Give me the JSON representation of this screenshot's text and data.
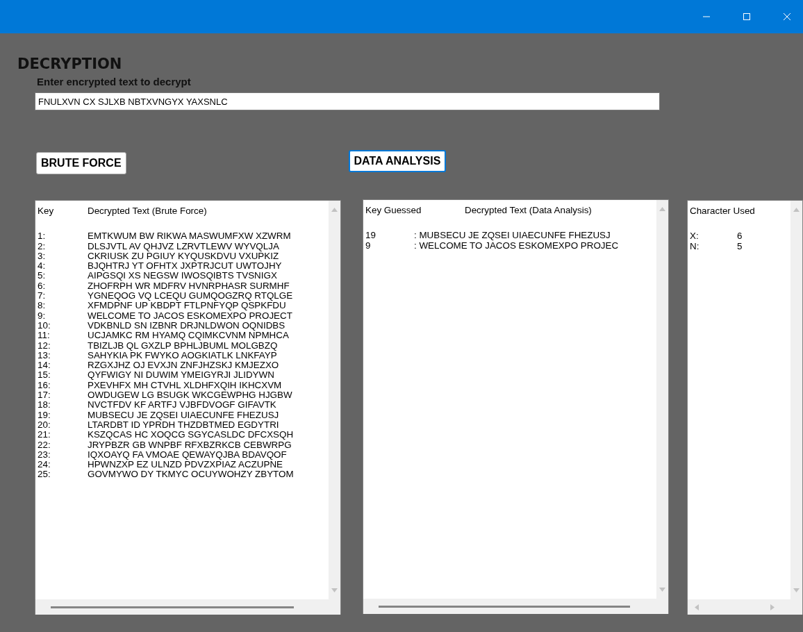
{
  "heading": "DECRYPTION",
  "prompt": "Enter encrypted text to decrypt",
  "input": {
    "value": "FNULXVN CX SJLXB NBTXVNGYX YAXSNLC"
  },
  "buttons": [
    {
      "label": "BRUTE FORCE",
      "focused": false
    },
    {
      "label": "DATA ANALYSIS",
      "focused": true
    }
  ],
  "brute_force": {
    "columns": [
      "Key",
      "Decrypted Text (Brute Force)"
    ],
    "rows": [
      {
        "key": "1:",
        "text": "EMTKWUM BW RIKWA MASWUMFXW XZWRM"
      },
      {
        "key": "2:",
        "text": "DLSJVTL AV QHJVZ LZRVTLEWV WYVQLJA"
      },
      {
        "key": "3:",
        "text": "CKRIUSK ZU PGIUY KYQUSKDVU VXUPKIZ"
      },
      {
        "key": "4:",
        "text": "BJQHTRJ YT OFHTX JXPTRJCUT UWTOJHY"
      },
      {
        "key": "5:",
        "text": "AIPGSQI XS NEGSW IWOSQIBTS TVSNIGX"
      },
      {
        "key": "6:",
        "text": "ZHOFRPH WR MDFRV HVNRPHASR SURMHF"
      },
      {
        "key": "7:",
        "text": "YGNEQOG VQ LCEQU GUMQOGZRQ RTQLGE"
      },
      {
        "key": "8:",
        "text": "XFMDPNF UP KBDPT FTLPNFYQP QSPKFDU"
      },
      {
        "key": "9:",
        "text": "WELCOME TO JACOS ESKOMEXPO PROJECT"
      },
      {
        "key": "10:",
        "text": "VDKBNLD SN IZBNR DRJNLDWON OQNIDBS"
      },
      {
        "key": "11:",
        "text": "UCJAMKC RM HYAMQ CQIMKCVNM NPMHCA"
      },
      {
        "key": "12:",
        "text": "TBIZLJB QL GXZLP BPHLJBUML MOLGBZQ"
      },
      {
        "key": "13:",
        "text": "SAHYKIA PK FWYKO AOGKIATLK LNKFAYP"
      },
      {
        "key": "14:",
        "text": "RZGXJHZ OJ EVXJN ZNFJHZSKJ KMJEZXO"
      },
      {
        "key": "15:",
        "text": "QYFWIGY NI DUWIM YMEIGYRJI JLIDYWN"
      },
      {
        "key": "16:",
        "text": "PXEVHFX MH CTVHL XLDHFXQIH IKHCXVM"
      },
      {
        "key": "17:",
        "text": "OWDUGEW LG BSUGK WKCGEWPHG HJGBW"
      },
      {
        "key": "18:",
        "text": "NVCTFDV KF ARTFJ VJBFDVOGF GIFAVTK"
      },
      {
        "key": "19:",
        "text": "MUBSECU JE ZQSEI UIAECUNFE FHEZUSJ"
      },
      {
        "key": "20:",
        "text": "LTARDBT ID YPRDH THZDBTMED EGDYTRI"
      },
      {
        "key": "21:",
        "text": "KSZQCAS HC XOQCG SGYCASLDC DFCXSQH"
      },
      {
        "key": "22:",
        "text": "JRYPBZR GB WNPBF RFXBZRKCB CEBWRPG"
      },
      {
        "key": "23:",
        "text": "IQXOAYQ FA VMOAE QEWAYQJBA BDAVQOF"
      },
      {
        "key": "24:",
        "text": "HPWNZXP EZ ULNZD PDVZXPIAZ ACZUPNE"
      },
      {
        "key": "25:",
        "text": "GOVMYWO DY TKMYC OCUYWOHZY ZBYTOM"
      }
    ]
  },
  "data_analysis": {
    "columns": [
      "Key Guessed",
      "Decrypted Text (Data Analysis)"
    ],
    "rows": [
      {
        "key": "19",
        "text": ": MUBSECU JE ZQSEI UIAECUNFE FHEZUSJ"
      },
      {
        "key": "9",
        "text": ": WELCOME TO JACOS ESKOMEXPO PROJEC"
      }
    ]
  },
  "characters": {
    "columns": [
      "Character Used"
    ],
    "rows": [
      {
        "char": "X:",
        "count": "6"
      },
      {
        "char": "N:",
        "count": "5"
      }
    ]
  }
}
